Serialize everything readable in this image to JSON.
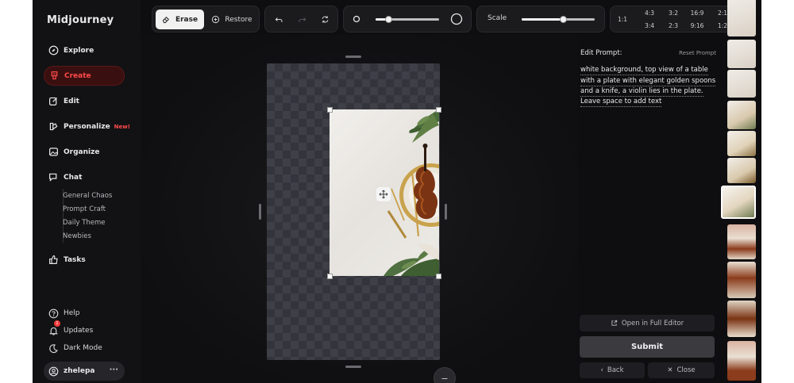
{
  "app": {
    "name": "Midjourney"
  },
  "sidebar": {
    "items": [
      {
        "label": "Explore",
        "icon": "compass-icon"
      },
      {
        "label": "Create",
        "icon": "brush-icon",
        "active": true
      },
      {
        "label": "Edit",
        "icon": "edit-icon"
      },
      {
        "label": "Personalize",
        "icon": "personalize-icon",
        "badge": "New!"
      },
      {
        "label": "Organize",
        "icon": "image-icon"
      },
      {
        "label": "Chat",
        "icon": "chat-icon"
      },
      {
        "label": "Tasks",
        "icon": "thumbs-up-icon"
      }
    ],
    "chat_rooms": [
      "General Chaos",
      "Prompt Craft",
      "Daily Theme",
      "Newbies"
    ],
    "bottom": {
      "help": "Help",
      "updates": "Updates",
      "updates_count": "1",
      "dark_mode": "Dark Mode"
    },
    "user": {
      "name": "zhelepa",
      "more": "···"
    }
  },
  "toolbar": {
    "erase_label": "Erase",
    "restore_label": "Restore",
    "brush_size_value": 0.2,
    "scale_label": "Scale",
    "scale_value": 0.57,
    "aspect_ratios": [
      "1:1",
      "4:3",
      "3:2",
      "16:9",
      "2:1",
      "3:4",
      "2:3",
      "9:16",
      "1:2"
    ]
  },
  "editor": {
    "edit_prompt_label": "Edit Prompt:",
    "reset_prompt_label": "Reset Prompt",
    "prompt_lines": [
      "white background, top view of a table",
      "with a plate with elegant golden spoons",
      "and a knife, a violin lies in the plate.",
      "Leave space to add text"
    ],
    "open_full_editor": "Open in Full Editor",
    "submit": "Submit",
    "back": "Back",
    "close": "Close"
  },
  "colors": {
    "accent": "#ff4a4a",
    "background": "#0e0e10",
    "sidebar": "#121214"
  }
}
